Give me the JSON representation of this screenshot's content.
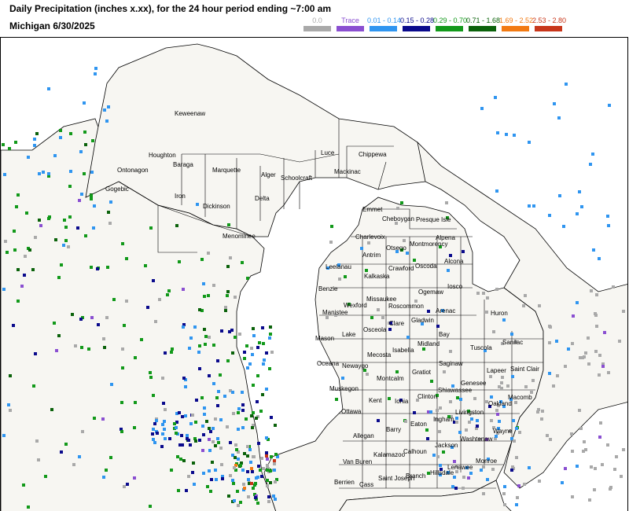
{
  "header": {
    "title": "Daily Precipitation (inches  x.xx),  for the 24 hour period ending ~7:00 am",
    "subtitle": "Michigan 6/30/2025"
  },
  "legend": [
    {
      "label": "0.0",
      "color": "#a9a9a9"
    },
    {
      "label": "Trace",
      "color": "#8a4fd1"
    },
    {
      "label": "0.01 - 0.14",
      "color": "#2f95f0"
    },
    {
      "label": "0.15 - 0.28",
      "color": "#0a0a8c"
    },
    {
      "label": "0.29 - 0.70",
      "color": "#12991a"
    },
    {
      "label": "0.71 - 1.68",
      "color": "#0b620b"
    },
    {
      "label": "1.69 - 2.52",
      "color": "#f27a12"
    },
    {
      "label": "2.53 - 2.80",
      "color": "#c8361a"
    }
  ],
  "colors": {
    "land": "#f7f6f2",
    "water": "#ffffff",
    "border": "#000000"
  },
  "counties": [
    {
      "name": "Keweenaw"
    },
    {
      "name": "Houghton"
    },
    {
      "name": "Baraga"
    },
    {
      "name": "Ontonagon"
    },
    {
      "name": "Gogebic"
    },
    {
      "name": "Iron"
    },
    {
      "name": "Marquette"
    },
    {
      "name": "Dickinson"
    },
    {
      "name": "Menominee"
    },
    {
      "name": "Delta"
    },
    {
      "name": "Alger"
    },
    {
      "name": "Schoolcraft"
    },
    {
      "name": "Luce"
    },
    {
      "name": "Chippewa"
    },
    {
      "name": "Mackinac"
    },
    {
      "name": "Emmet"
    },
    {
      "name": "Cheboygan"
    },
    {
      "name": "Presque Isle"
    },
    {
      "name": "Charlevoix"
    },
    {
      "name": "Antrim"
    },
    {
      "name": "Otsego"
    },
    {
      "name": "Montmorency"
    },
    {
      "name": "Alpena"
    },
    {
      "name": "Leelanau"
    },
    {
      "name": "Kalkaska"
    },
    {
      "name": "Crawford"
    },
    {
      "name": "Oscoda"
    },
    {
      "name": "Alcona"
    },
    {
      "name": "Benzie"
    },
    {
      "name": "Wexford"
    },
    {
      "name": "Missaukee"
    },
    {
      "name": "Ogemaw"
    },
    {
      "name": "Iosco"
    },
    {
      "name": "Manistee"
    },
    {
      "name": "Roscommon"
    },
    {
      "name": "Arenac"
    },
    {
      "name": "Huron"
    },
    {
      "name": "Mason"
    },
    {
      "name": "Lake"
    },
    {
      "name": "Osceola"
    },
    {
      "name": "Clare"
    },
    {
      "name": "Gladwin"
    },
    {
      "name": "Bay"
    },
    {
      "name": "Tuscola"
    },
    {
      "name": "Sanilac"
    },
    {
      "name": "Oceana"
    },
    {
      "name": "Newaygo"
    },
    {
      "name": "Mecosta"
    },
    {
      "name": "Isabella"
    },
    {
      "name": "Midland"
    },
    {
      "name": "Saginaw"
    },
    {
      "name": "Lapeer"
    },
    {
      "name": "Saint Clair"
    },
    {
      "name": "Muskegon"
    },
    {
      "name": "Montcalm"
    },
    {
      "name": "Gratiot"
    },
    {
      "name": "Genesee"
    },
    {
      "name": "Ottawa"
    },
    {
      "name": "Kent"
    },
    {
      "name": "Ionia"
    },
    {
      "name": "Clinton"
    },
    {
      "name": "Shiawassee"
    },
    {
      "name": "Oakland"
    },
    {
      "name": "Macomb"
    },
    {
      "name": "Livingston"
    },
    {
      "name": "Allegan"
    },
    {
      "name": "Barry"
    },
    {
      "name": "Eaton"
    },
    {
      "name": "Ingham"
    },
    {
      "name": "Washtenaw"
    },
    {
      "name": "Wayne"
    },
    {
      "name": "Van Buren"
    },
    {
      "name": "Kalamazoo"
    },
    {
      "name": "Calhoun"
    },
    {
      "name": "Jackson"
    },
    {
      "name": "Monroe"
    },
    {
      "name": "Lenawee"
    },
    {
      "name": "Hillsdale"
    },
    {
      "name": "Branch"
    },
    {
      "name": "Saint Joseph"
    },
    {
      "name": "Cass"
    },
    {
      "name": "Berrien"
    }
  ]
}
